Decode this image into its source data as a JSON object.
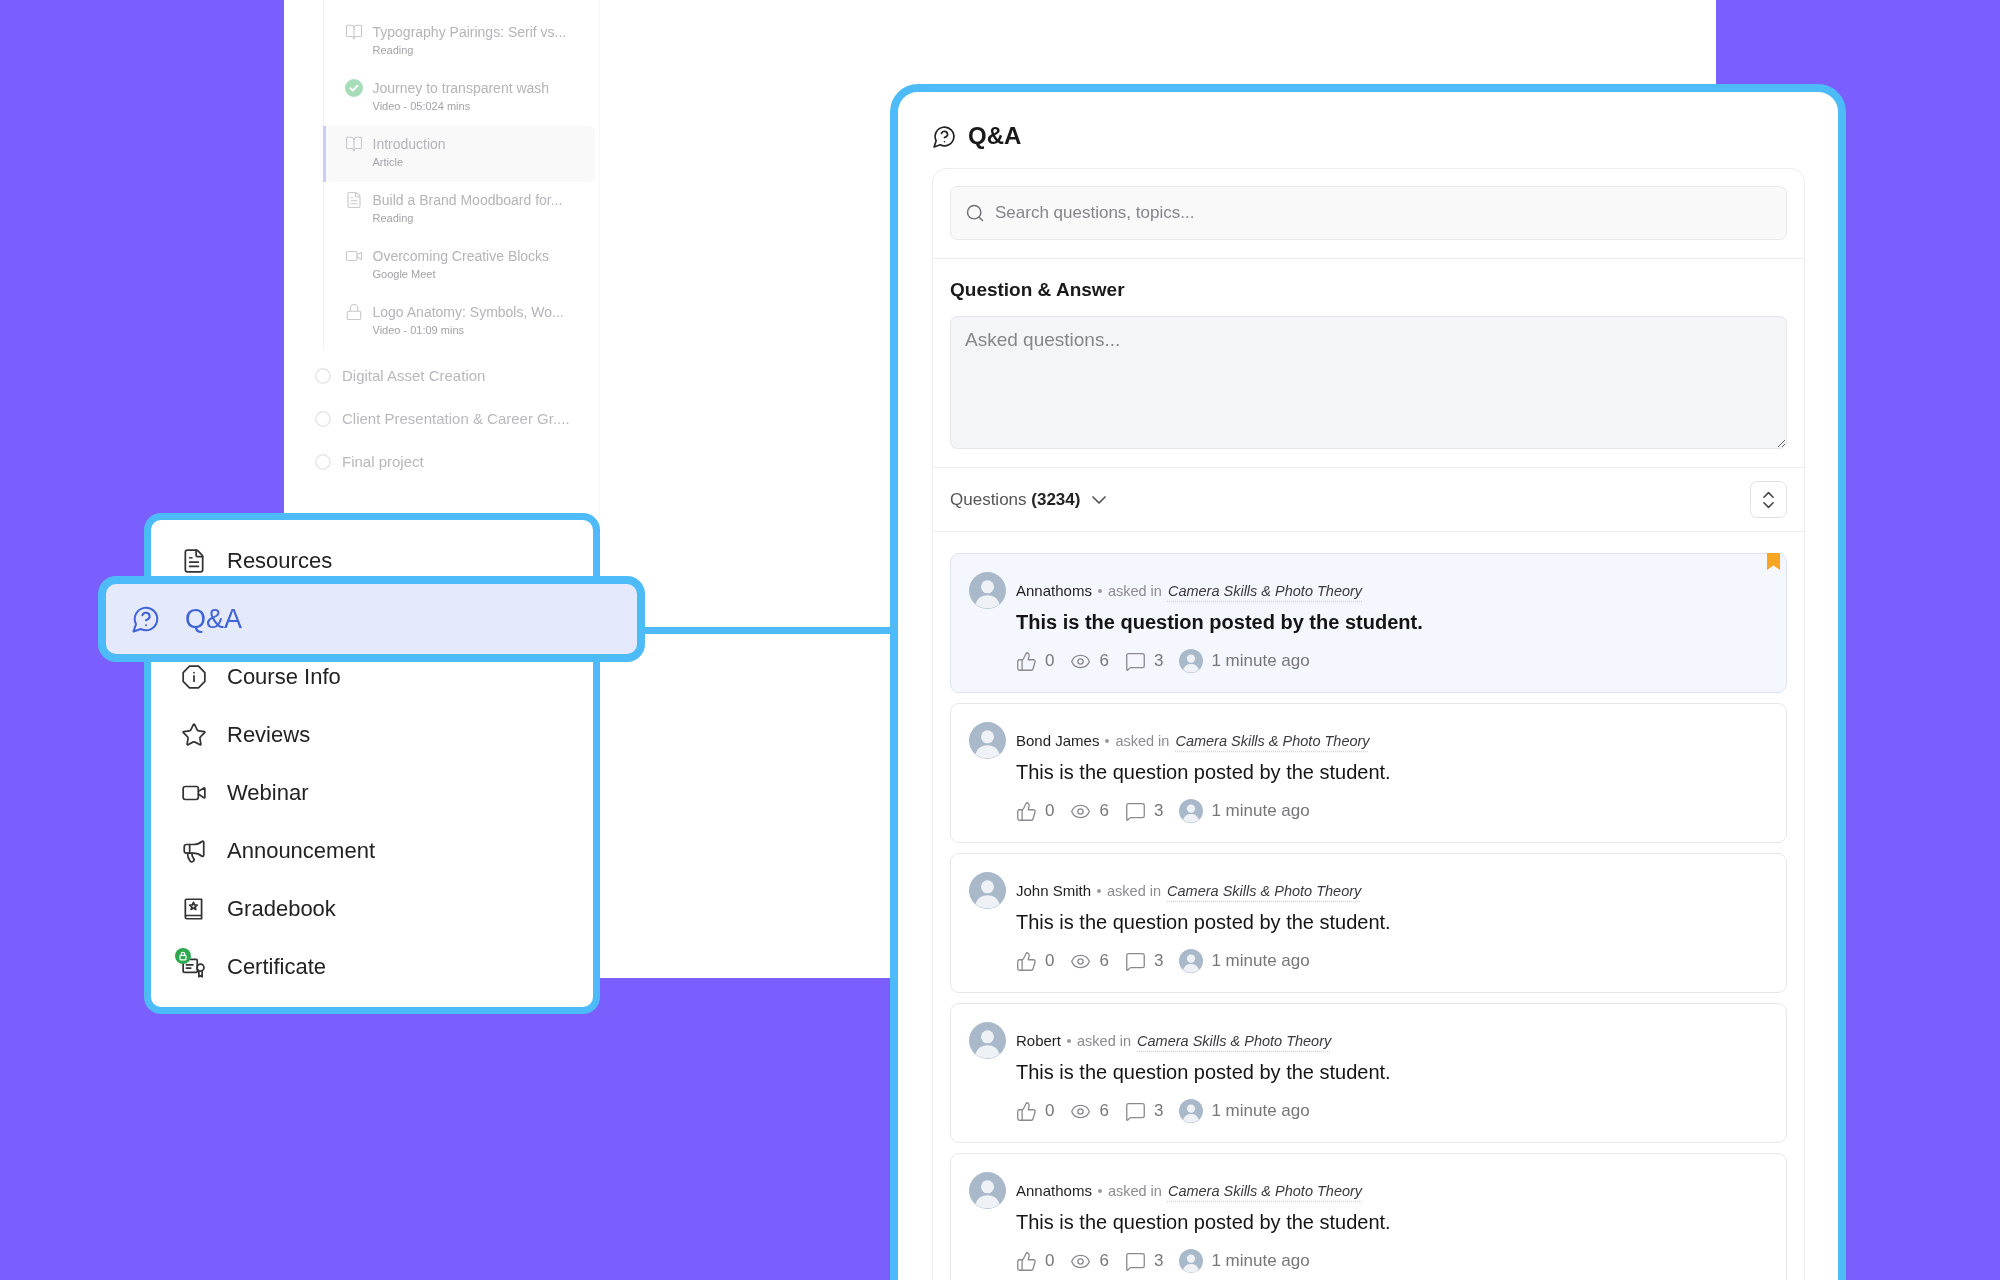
{
  "course_outline": {
    "lessons": [
      {
        "title": "Typography Pairings: Serif vs...",
        "meta": "Reading",
        "kind": "book",
        "selected": false
      },
      {
        "title": "Journey to transparent wash",
        "meta": "Video - 05:024 mins",
        "kind": "completed",
        "selected": false
      },
      {
        "title": "Introduction",
        "meta": "Article",
        "kind": "book",
        "selected": true
      },
      {
        "title": "Build a Brand Moodboard for...",
        "meta": "Reading",
        "kind": "document",
        "selected": false
      },
      {
        "title": "Overcoming Creative Blocks",
        "meta": "Google Meet",
        "kind": "video",
        "selected": false
      },
      {
        "title": "Logo Anatomy: Symbols, Wo...",
        "meta": "Video - 01:09 mins",
        "kind": "locked",
        "selected": false
      }
    ],
    "sections": [
      {
        "title": "Digital Asset Creation",
        "completed": false
      },
      {
        "title": "Client Presentation & Career Gr....",
        "completed": false
      },
      {
        "title": "Final project",
        "completed": false
      }
    ]
  },
  "course_menu": {
    "items": [
      {
        "label": "Resources",
        "kind": "resources",
        "selected": false,
        "lock_badge": false
      },
      {
        "label": "Q&A",
        "kind": "qa",
        "selected": true,
        "lock_badge": false
      },
      {
        "label": "Course Info",
        "kind": "info",
        "selected": false,
        "lock_badge": false
      },
      {
        "label": "Reviews",
        "kind": "reviews",
        "selected": false,
        "lock_badge": false
      },
      {
        "label": "Webinar",
        "kind": "webinar",
        "selected": false,
        "lock_badge": false
      },
      {
        "label": "Announcement",
        "kind": "announcement",
        "selected": false,
        "lock_badge": false
      },
      {
        "label": "Gradebook",
        "kind": "gradebook",
        "selected": false,
        "lock_badge": false
      },
      {
        "label": "Certificate",
        "kind": "certificate",
        "selected": false,
        "lock_badge": true
      }
    ]
  },
  "qa_panel": {
    "title": "Q&A",
    "search": {
      "placeholder": "Search questions, topics..."
    },
    "composer": {
      "title": "Question & Answer",
      "placeholder": "Asked questions..."
    },
    "filter": {
      "label": "Questions **(3234)**"
    },
    "questions": [
      {
        "author": "Annathoms",
        "asked_in": "asked in",
        "topic": "Camera Skills & Photo Theory",
        "text": "This is the question posted by the student.",
        "likes": "0",
        "views": "6",
        "replies": "3",
        "time": "1 minute ago",
        "selected": true,
        "bookmarked": true
      },
      {
        "author": "Bond James",
        "asked_in": "asked in",
        "topic": "Camera Skills & Photo Theory",
        "text": "This is the question posted by the student.",
        "likes": "0",
        "views": "6",
        "replies": "3",
        "time": "1 minute ago",
        "selected": false,
        "bookmarked": false
      },
      {
        "author": "John Smith",
        "asked_in": "asked in",
        "topic": "Camera Skills & Photo Theory",
        "text": "This is the question posted by the student.",
        "likes": "0",
        "views": "6",
        "replies": "3",
        "time": "1 minute ago",
        "selected": false,
        "bookmarked": false
      },
      {
        "author": "Robert",
        "asked_in": "asked in",
        "topic": "Camera Skills & Photo Theory",
        "text": "This is the question posted by the student.",
        "likes": "0",
        "views": "6",
        "replies": "3",
        "time": "1 minute ago",
        "selected": false,
        "bookmarked": false
      },
      {
        "author": "Annathoms",
        "asked_in": "asked in",
        "topic": "Camera Skills & Photo Theory",
        "text": "This is the question posted by the student.",
        "likes": "0",
        "views": "6",
        "replies": "3",
        "time": "1 minute ago",
        "selected": false,
        "bookmarked": false
      }
    ]
  }
}
